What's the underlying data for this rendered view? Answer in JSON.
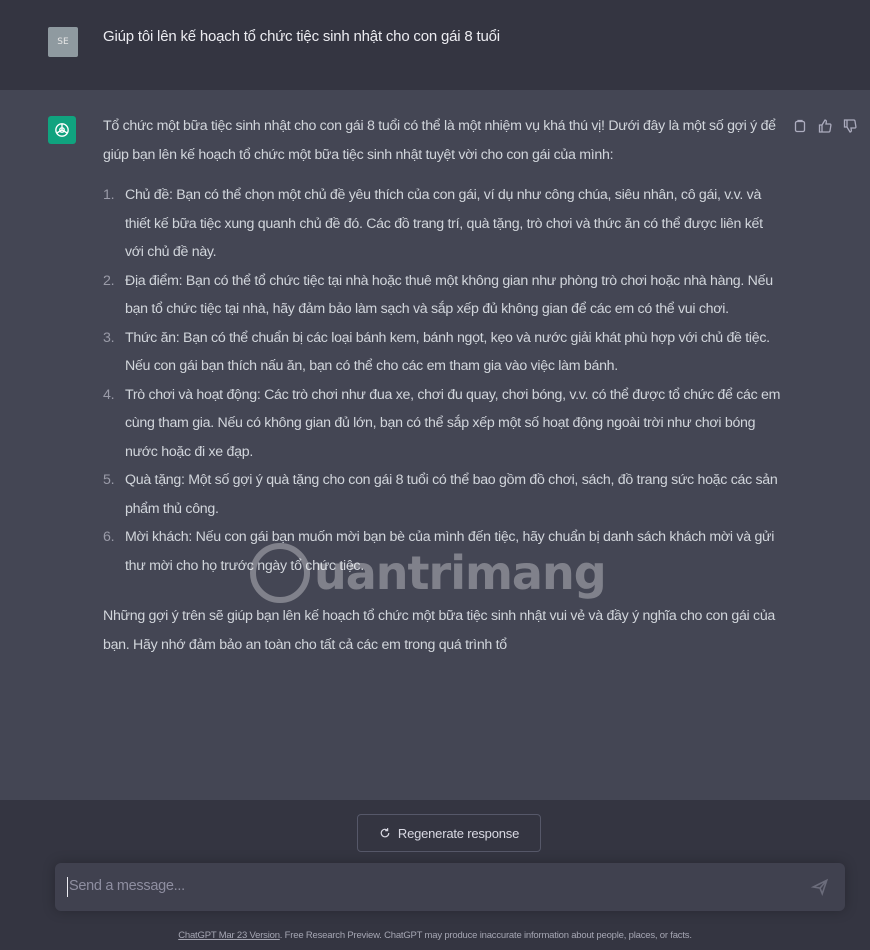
{
  "user_message": {
    "avatar_initials": "SE",
    "text": "Giúp tôi lên kế hoạch tổ chức tiệc sinh nhật cho con gái 8 tuổi"
  },
  "assistant_message": {
    "intro": "Tổ chức một bữa tiệc sinh nhật cho con gái 8 tuổi có thể là một nhiệm vụ khá thú vị! Dưới đây là một số gợi ý để giúp bạn lên kế hoạch tổ chức một bữa tiệc sinh nhật tuyệt vời cho con gái của mình:",
    "items": [
      {
        "num": "1.",
        "text": "Chủ đề: Bạn có thể chọn một chủ đề yêu thích của con gái, ví dụ như công chúa, siêu nhân, cô gái, v.v. và thiết kế bữa tiệc xung quanh chủ đề đó. Các đồ trang trí, quà tặng, trò chơi và thức ăn có thể được liên kết với chủ đề này."
      },
      {
        "num": "2.",
        "text": "Địa điểm: Bạn có thể tổ chức tiệc tại nhà hoặc thuê một không gian như phòng trò chơi hoặc nhà hàng. Nếu bạn tổ chức tiệc tại nhà, hãy đảm bảo làm sạch và sắp xếp đủ không gian để các em có thể vui chơi."
      },
      {
        "num": "3.",
        "text": "Thức ăn: Bạn có thể chuẩn bị các loại bánh kem, bánh ngọt, kẹo và nước giải khát phù hợp với chủ đề tiệc. Nếu con gái bạn thích nấu ăn, bạn có thể cho các em tham gia vào việc làm bánh."
      },
      {
        "num": "4.",
        "text": "Trò chơi và hoạt động: Các trò chơi như đua xe, chơi đu quay, chơi bóng, v.v. có thể được tổ chức để các em cùng tham gia. Nếu có không gian đủ lớn, bạn có thể sắp xếp một số hoạt động ngoài trời như chơi bóng nước hoặc đi xe đạp."
      },
      {
        "num": "5.",
        "text": "Quà tặng: Một số gợi ý quà tặng cho con gái 8 tuổi có thể bao gồm đồ chơi, sách, đồ trang sức hoặc các sản phẩm thủ công."
      },
      {
        "num": "6.",
        "text": "Mời khách: Nếu con gái bạn muốn mời bạn bè của mình đến tiệc, hãy chuẩn bị danh sách khách mời và gửi thư mời cho họ trước ngày tổ chức tiệc."
      }
    ],
    "closing": "Những gợi ý trên sẽ giúp bạn lên kế hoạch tổ chức một bữa tiệc sinh nhật vui vẻ và đầy ý nghĩa cho con gái của bạn. Hãy nhớ đảm bảo an toàn cho tất cả các em trong quá trình tổ"
  },
  "watermark": {
    "text": "uantrimang"
  },
  "controls": {
    "regenerate_label": "Regenerate response",
    "input_placeholder": "Send a message..."
  },
  "footer": {
    "link_text": "ChatGPT Mar 23 Version",
    "text": ". Free Research Preview. ChatGPT may produce inaccurate information about people, places, or facts."
  },
  "colors": {
    "background": "#343541",
    "assistant_background": "#444654",
    "brand_green": "#10a37f",
    "composer": "#40414f"
  },
  "icons": [
    "openai-logo-icon",
    "copy-icon",
    "thumbs-up-icon",
    "thumbs-down-icon",
    "refresh-icon",
    "send-icon"
  ]
}
